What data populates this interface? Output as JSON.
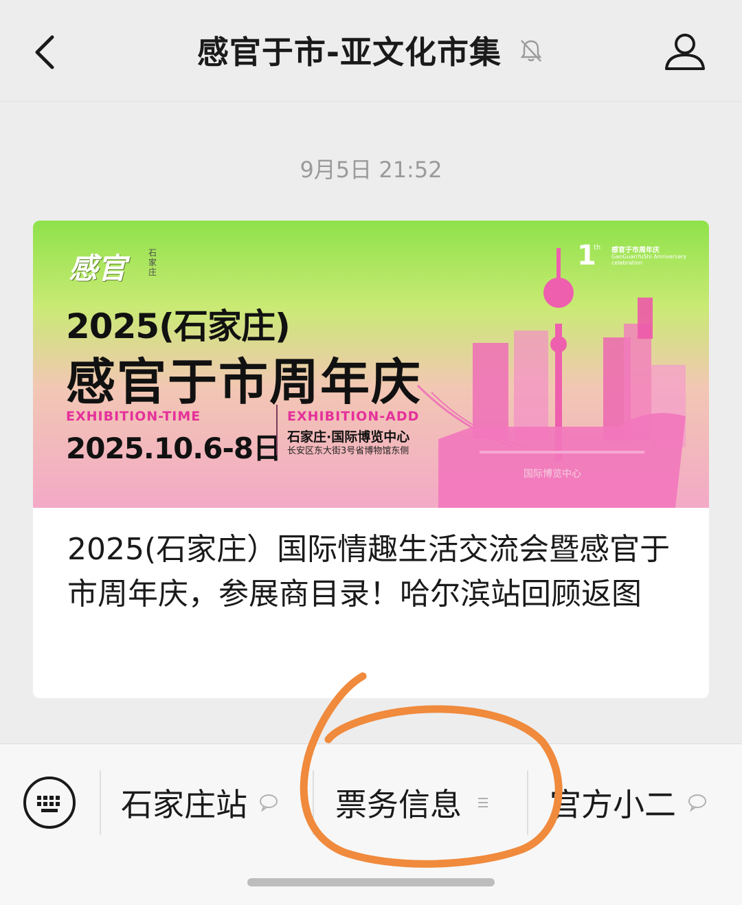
{
  "header": {
    "title": "感官于市-亚文化市集",
    "back_icon": "chevron-left-icon",
    "mute_icon": "bell-off-icon",
    "profile_icon": "person-icon"
  },
  "chat": {
    "timestamp": "9月5日 21:52"
  },
  "article_card": {
    "banner": {
      "logo": "感官",
      "logo_city": "石家庄",
      "anniversary_number": "1",
      "anniversary_suffix": "th",
      "anniversary_cn": "感官于市周年庆",
      "anniversary_en": "GanGuanYuShi Anniversary celebration",
      "year_line": "2025(石家庄)",
      "headline": "感官于市周年庆",
      "time_label": "EXHIBITION-TIME",
      "date": "2025.10.6-8日",
      "address_label": "EXHIBITION-ADD",
      "venue": "石家庄·国际博览中心",
      "address": "长安区东大街3号省博物馆东侧",
      "building_sign": "国际博览中心"
    },
    "title": "2025(石家庄）国际情趣生活交流会暨感官于市周年庆，参展商目录！哈尔滨站回顾返图"
  },
  "bottom_menu": {
    "keyboard_icon": "keyboard-icon",
    "items": [
      {
        "label": "石家庄站",
        "icon": "speech-bubble-icon"
      },
      {
        "label": "票务信息",
        "icon": "menu-lines-icon"
      },
      {
        "label": "官方小二",
        "icon": "speech-bubble-icon"
      }
    ]
  },
  "colors": {
    "background": "#ededed",
    "banner_green": "#8ee24a",
    "banner_pink": "#f3a9c6",
    "accent_magenta": "#e4319a",
    "annotation_orange": "#f08a3c"
  }
}
